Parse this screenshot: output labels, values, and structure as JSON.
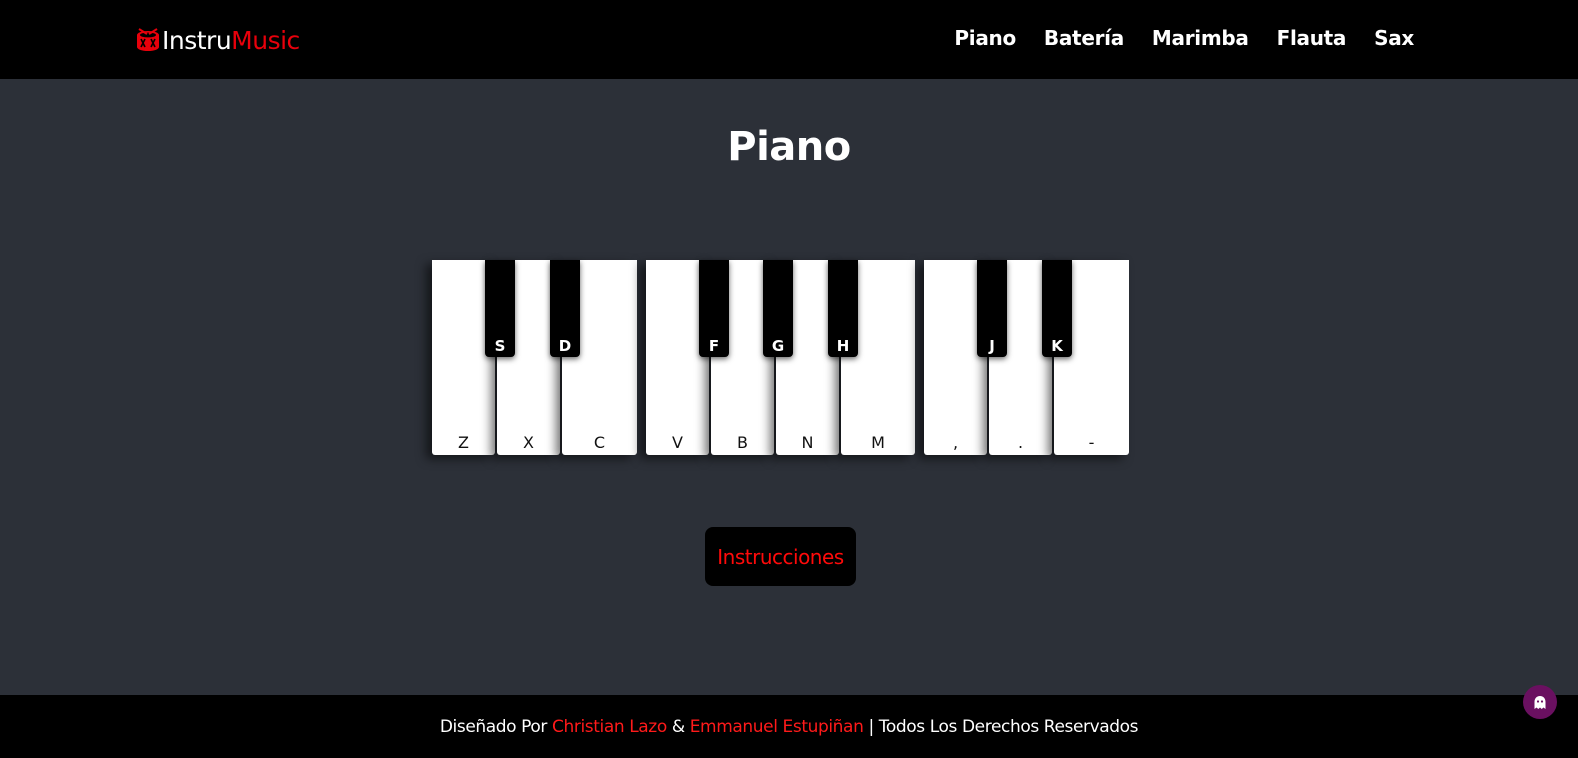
{
  "brand": {
    "part1": "Instru",
    "part2": "Music"
  },
  "nav": [
    "Piano",
    "Batería",
    "Marimba",
    "Flauta",
    "Sax"
  ],
  "title": "Piano",
  "white_keys": [
    "Z",
    "X",
    "C",
    "V",
    "B",
    "N",
    "M",
    ",",
    ".",
    "-"
  ],
  "black_keys": [
    "S",
    "D",
    "F",
    "G",
    "H",
    "J",
    "K"
  ],
  "instructions_button": "Instrucciones",
  "footer": {
    "prefix": "Diseñado Por",
    "author1": "Christian Lazo",
    "amp": "&",
    "author2": "Emmanuel Estupiñan",
    "suffix": "| Todos Los Derechos Reservados"
  },
  "colors": {
    "accent": "#e8000b",
    "background": "#2c3038",
    "bar": "#000000",
    "widget": "#6a1060"
  },
  "icons": {
    "logo": "drum-icon",
    "widget": "ghost-icon"
  }
}
